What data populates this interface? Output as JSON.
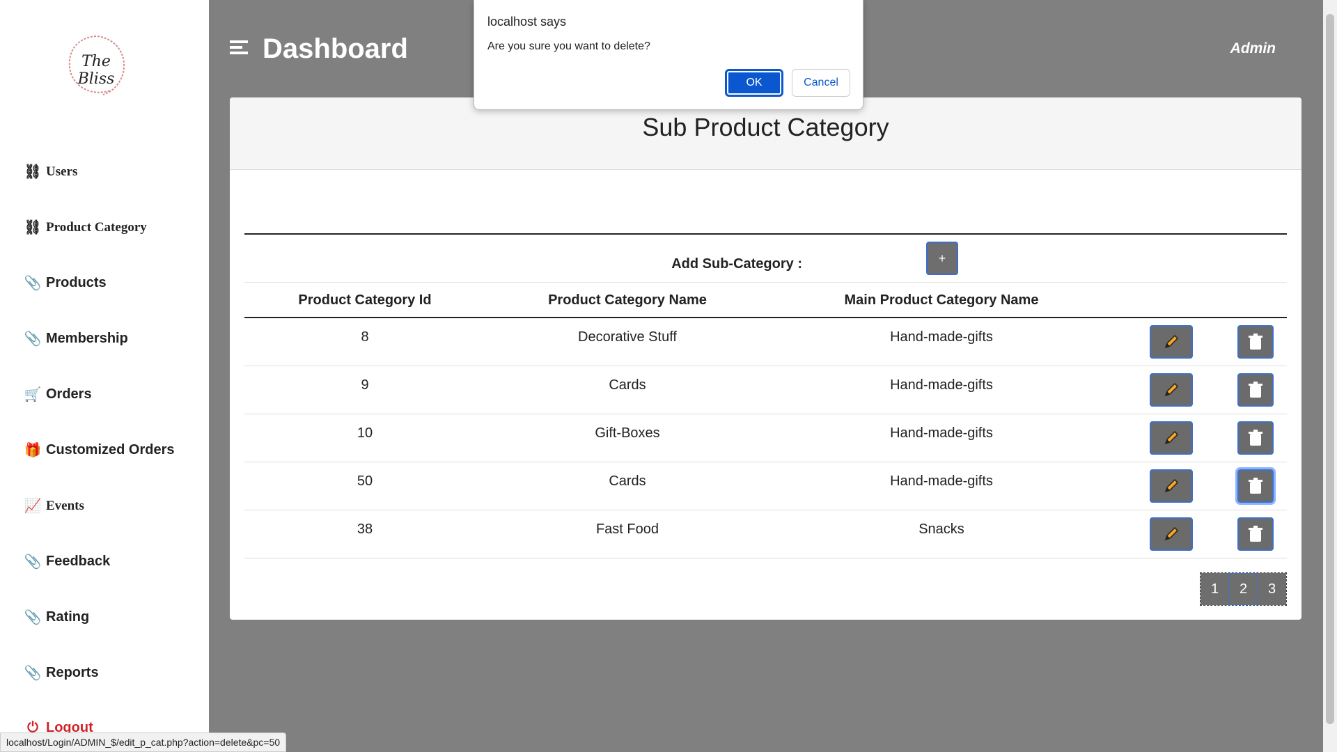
{
  "logo": {
    "text": "The Bliss"
  },
  "sidebar": {
    "items": [
      {
        "label": "Users",
        "icon": "sitemap-icon"
      },
      {
        "label": "Product Category",
        "icon": "sitemap-icon"
      },
      {
        "label": "Products",
        "icon": "paperclip-icon"
      },
      {
        "label": "Membership",
        "icon": "paperclip-icon"
      },
      {
        "label": "Orders",
        "icon": "cart-icon"
      },
      {
        "label": "Customized Orders",
        "icon": "gift-icon"
      },
      {
        "label": "Events",
        "icon": "chart-line-icon"
      },
      {
        "label": "Feedback",
        "icon": "paperclip-icon"
      },
      {
        "label": "Rating",
        "icon": "paperclip-icon"
      },
      {
        "label": "Reports",
        "icon": "paperclip-icon"
      },
      {
        "label": "Logout",
        "icon": "power-icon"
      }
    ]
  },
  "header": {
    "title": "Dashboard",
    "user": "Admin"
  },
  "card": {
    "title": "Sub Product Category",
    "add_label": "Add Sub-Category :",
    "add_button": "+",
    "columns": [
      "Product Category Id",
      "Product Category Name",
      "Main Product Category Name"
    ],
    "rows": [
      {
        "id": "8",
        "name": "Decorative Stuff",
        "main": "Hand-made-gifts"
      },
      {
        "id": "9",
        "name": "Cards",
        "main": "Hand-made-gifts"
      },
      {
        "id": "10",
        "name": "Gift-Boxes",
        "main": "Hand-made-gifts"
      },
      {
        "id": "50",
        "name": "Cards",
        "main": "Hand-made-gifts"
      },
      {
        "id": "38",
        "name": "Fast Food",
        "main": "Snacks"
      }
    ],
    "pages": [
      "1",
      "2",
      "3"
    ],
    "active_page": "2"
  },
  "dialog": {
    "title": "localhost says",
    "message": "Are you sure you want to delete?",
    "ok": "OK",
    "cancel": "Cancel"
  },
  "status_url": "localhost/Login/ADMIN_$/edit_p_cat.php?action=delete&pc=50",
  "colors": {
    "accent": "#0b57d0",
    "logout": "#d2232a",
    "background": "#808080"
  }
}
